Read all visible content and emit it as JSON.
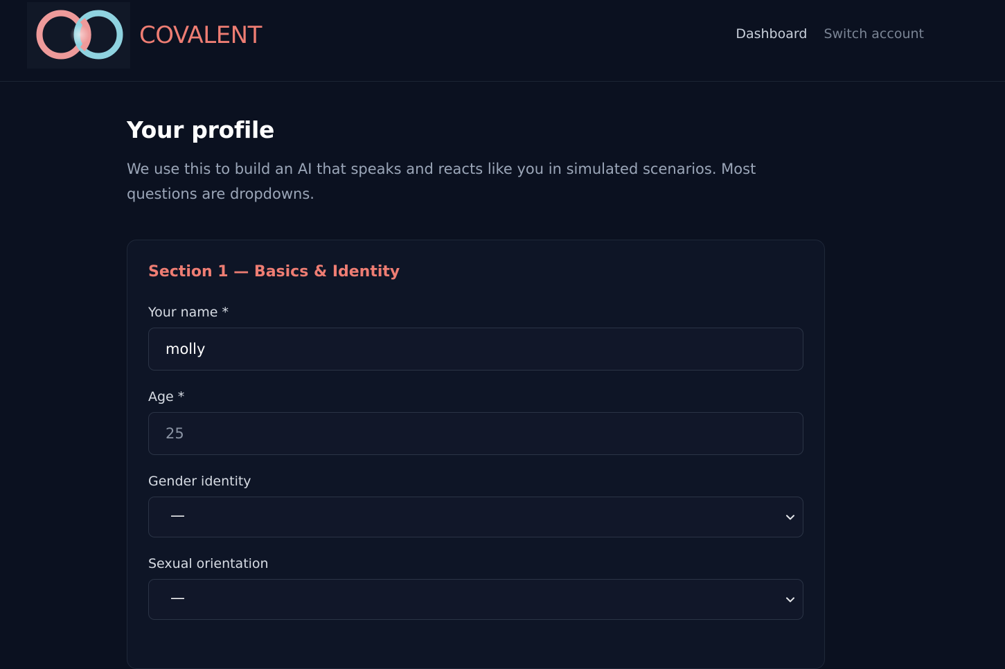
{
  "header": {
    "brand": "COVALENT",
    "nav": {
      "dashboard": "Dashboard",
      "switch_account": "Switch account"
    }
  },
  "page": {
    "title": "Your profile",
    "intro": "We use this to build an AI that speaks and reacts like you in simulated scenarios. Most questions are dropdowns."
  },
  "section": {
    "title": "Section 1 — Basics & Identity",
    "fields": {
      "name": {
        "label": "Your name *",
        "value": "molly"
      },
      "age": {
        "label": "Age *",
        "value": "",
        "placeholder": "25"
      },
      "gender": {
        "label": "Gender identity",
        "selected": "—"
      },
      "orientation": {
        "label": "Sexual orientation",
        "selected": "—"
      }
    }
  },
  "colors": {
    "accent": "#ee7d73",
    "logo_ring_left": "#ee9a9a",
    "logo_ring_right": "#8fd3e0",
    "background": "#0b1120"
  },
  "icons": {
    "logo": "linked-rings-logo-icon",
    "select_arrow": "chevron-down-icon"
  }
}
